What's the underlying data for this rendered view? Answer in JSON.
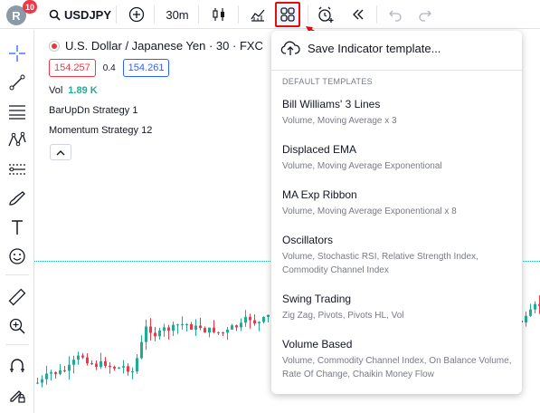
{
  "header": {
    "avatar_initial": "R",
    "notification_count": "10",
    "symbol": "USDJPY",
    "interval": "30m"
  },
  "legend": {
    "title": "U.S. Dollar / Japanese Yen · 30 · FXC",
    "sell_price": "154.257",
    "spread": "0.4",
    "buy_price": "154.261",
    "volume_label": "Vol",
    "volume_value": "1.89 K",
    "indicator_1": "BarUpDn Strategy 1",
    "indicator_2": "Momentum Strategy 12"
  },
  "menu": {
    "save_label": "Save Indicator template...",
    "section_label": "DEFAULT TEMPLATES",
    "templates": [
      {
        "name": "Bill Williams' 3 Lines",
        "desc": "Volume, Moving Average x 3"
      },
      {
        "name": "Displaced EMA",
        "desc": "Volume, Moving Average Exponentional"
      },
      {
        "name": "MA Exp Ribbon",
        "desc": "Volume, Moving Average Exponentional x 8"
      },
      {
        "name": "Oscillators",
        "desc": "Volume, Stochastic RSI, Relative Strength Index, Commodity Channel Index"
      },
      {
        "name": "Swing Trading",
        "desc": "Zig Zag, Pivots, Pivots HL, Vol"
      },
      {
        "name": "Volume Based",
        "desc": "Volume, Commodity Channel Index, On Balance Volume, Rate Of Change, Chaikin Money Flow"
      }
    ]
  },
  "colors": {
    "up": "#22ab94",
    "down": "#f23645",
    "highlight": "#e01010"
  }
}
